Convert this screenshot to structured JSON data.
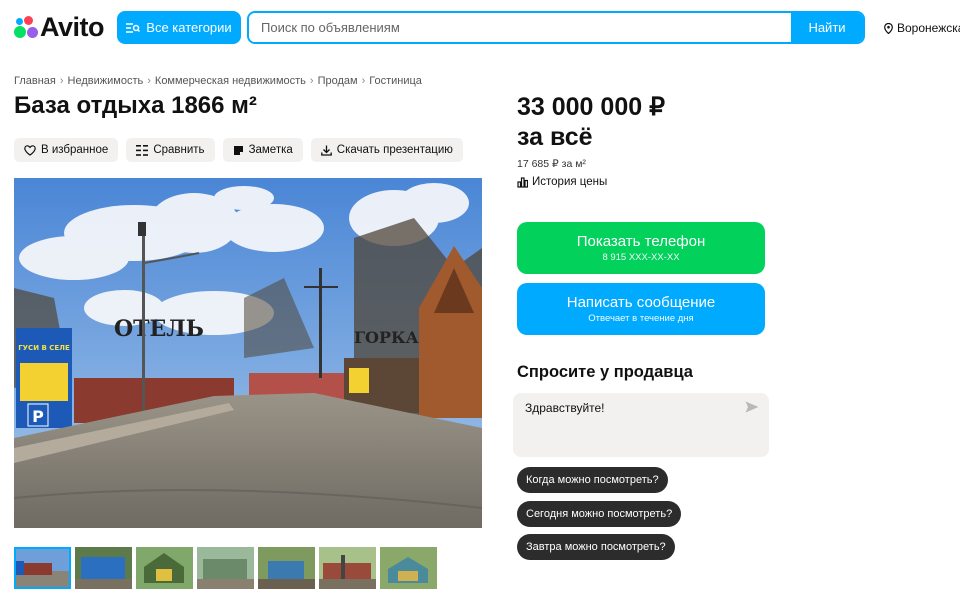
{
  "header": {
    "logo_text": "Avito",
    "categories_label": "Все категории",
    "search_placeholder": "Поиск по объявлениям",
    "search_button": "Найти",
    "location": "Воронежская"
  },
  "breadcrumbs": [
    {
      "label": "Главная"
    },
    {
      "label": "Недвижимость"
    },
    {
      "label": "Коммерческая недвижимость"
    },
    {
      "label": "Продам"
    },
    {
      "label": "Гостиница"
    }
  ],
  "breadcrumb_separator": "›",
  "listing": {
    "title": "База отдыха 1866 м²",
    "actions": {
      "favorite": "В избранное",
      "compare": "Сравнить",
      "note": "Заметка",
      "download": "Скачать презентацию"
    },
    "photo_signs": {
      "hotel": "ОТЕЛЬ",
      "gorka": "ГОРКА",
      "billboard": "ГУСИ В СЕЛЕ",
      "parking": "P"
    },
    "thumbnails_count": 7
  },
  "sidebar": {
    "price": "33 000 000 ₽",
    "price_suffix": "за всё",
    "price_per_meter": "17 685 ₽ за м²",
    "price_history": "История цены",
    "show_phone": {
      "label": "Показать телефон",
      "sub": "8 915 XXX-XX-XX"
    },
    "write_message": {
      "label": "Написать сообщение",
      "sub": "Отвечает в течение дня"
    },
    "ask_seller_title": "Спросите у продавца",
    "ask_message": "Здравствуйте!",
    "quick_questions": [
      "Когда можно посмотреть?",
      "Сегодня можно посмотреть?",
      "Завтра можно посмотреть?"
    ]
  },
  "colors": {
    "accent_blue": "#00aaff",
    "accent_green": "#02d15c",
    "chip_dark": "#2c2c2c",
    "button_gray": "#f2f1f0"
  }
}
